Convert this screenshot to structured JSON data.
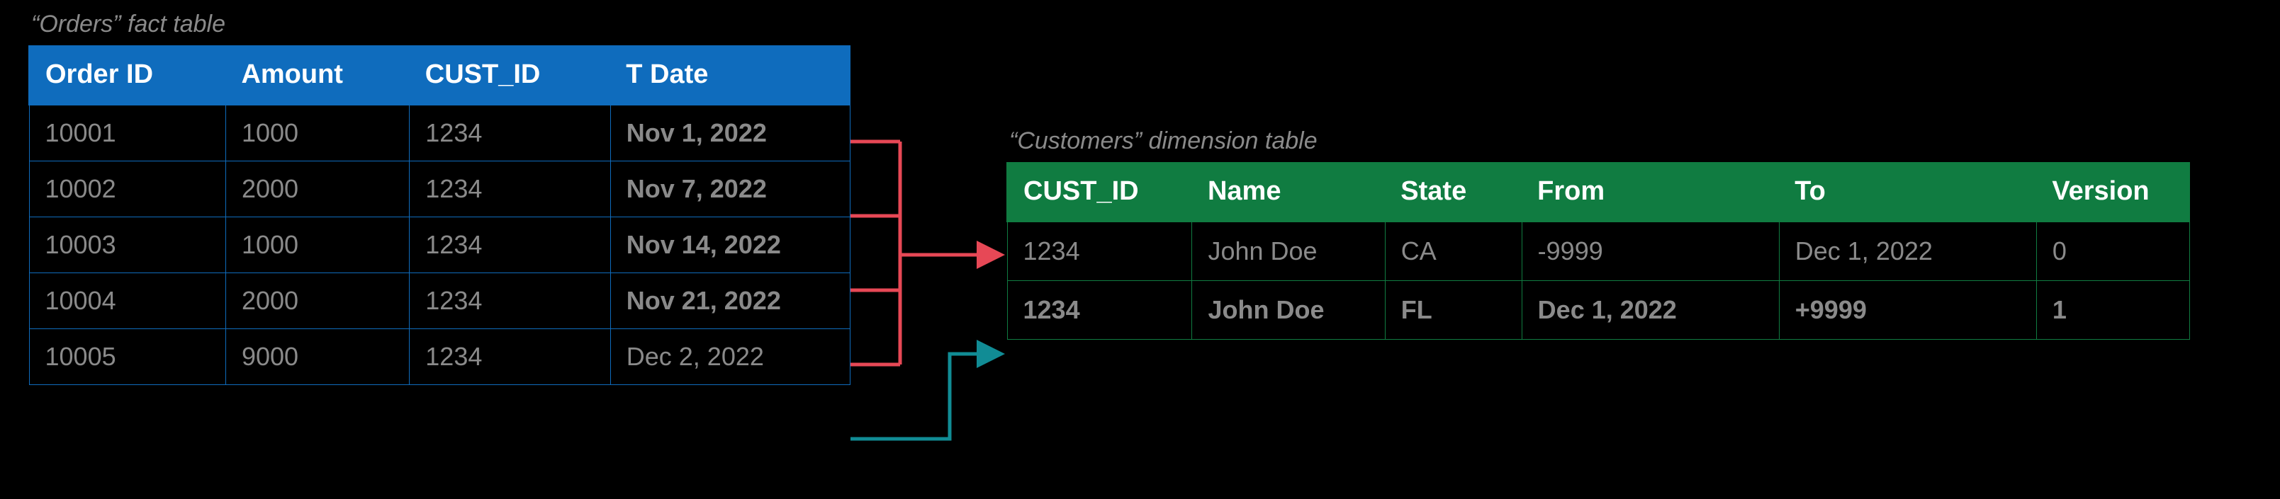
{
  "orders": {
    "caption": "“Orders” fact table",
    "headers": {
      "order_id": "Order ID",
      "amount": "Amount",
      "cust_id": "CUST_ID",
      "tdate": "T Date"
    },
    "rows": [
      {
        "order_id": "10001",
        "amount": "1000",
        "cust_id": "1234",
        "tdate": "Nov 1, 2022",
        "date_bold": true
      },
      {
        "order_id": "10002",
        "amount": "2000",
        "cust_id": "1234",
        "tdate": "Nov 7, 2022",
        "date_bold": true
      },
      {
        "order_id": "10003",
        "amount": "1000",
        "cust_id": "1234",
        "tdate": "Nov 14, 2022",
        "date_bold": true
      },
      {
        "order_id": "10004",
        "amount": "2000",
        "cust_id": "1234",
        "tdate": "Nov 21, 2022",
        "date_bold": true
      },
      {
        "order_id": "10005",
        "amount": "9000",
        "cust_id": "1234",
        "tdate": "Dec 2, 2022",
        "date_bold": false
      }
    ]
  },
  "customers": {
    "caption": "“Customers” dimension table",
    "headers": {
      "cust_id": "CUST_ID",
      "name": "Name",
      "state": "State",
      "from": "From",
      "to": "To",
      "version": "Version"
    },
    "rows": [
      {
        "cust_id": "1234",
        "name": "John Doe",
        "state": "CA",
        "from": "-9999",
        "to": "Dec 1, 2022",
        "version": "0",
        "bold": false
      },
      {
        "cust_id": "1234",
        "name": "John Doe",
        "state": "FL",
        "from": "Dec 1, 2022",
        "to": "+9999",
        "version": "1",
        "bold": true
      }
    ]
  },
  "connectors": {
    "pink_color": "#e74856",
    "teal_color": "#118c95"
  }
}
